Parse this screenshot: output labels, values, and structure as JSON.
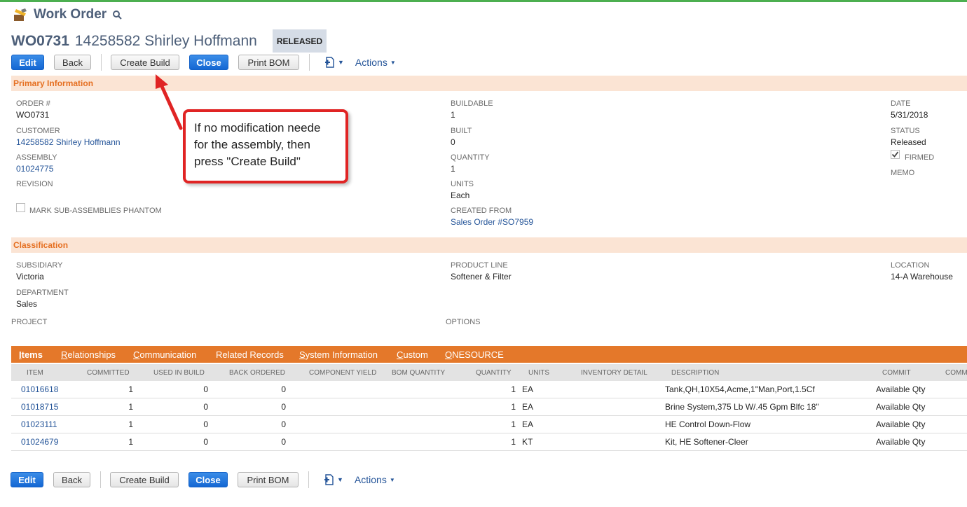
{
  "page": {
    "title": "Work Order",
    "record_id": "WO0731",
    "record_name": "14258582 Shirley Hoffmann",
    "status": "RELEASED"
  },
  "buttons": {
    "edit": "Edit",
    "back": "Back",
    "create_build": "Create Build",
    "close": "Close",
    "print_bom": "Print BOM",
    "actions": "Actions"
  },
  "primary": {
    "header": "Primary Information",
    "order_label": "ORDER #",
    "order_value": "WO0731",
    "customer_label": "CUSTOMER",
    "customer_value": "14258582 Shirley Hoffmann",
    "assembly_label": "ASSEMBLY",
    "assembly_value": "01024775",
    "revision_label": "REVISION",
    "phantom_label": "MARK SUB-ASSEMBLIES PHANTOM",
    "buildable_label": "BUILDABLE",
    "buildable_value": "1",
    "built_label": "BUILT",
    "built_value": "0",
    "quantity_label": "QUANTITY",
    "quantity_value": "1",
    "units_label": "UNITS",
    "units_value": "Each",
    "created_from_label": "CREATED FROM",
    "created_from_value": "Sales Order #SO7959",
    "date_label": "DATE",
    "date_value": "5/31/2018",
    "status_label": "STATUS",
    "status_value": "Released",
    "firmed_label": "FIRMED",
    "memo_label": "MEMO"
  },
  "classification": {
    "header": "Classification",
    "subsidiary_label": "SUBSIDIARY",
    "subsidiary_value": "Victoria",
    "department_label": "DEPARTMENT",
    "department_value": "Sales",
    "product_line_label": "PRODUCT LINE",
    "product_line_value": "Softener & Filter",
    "location_label": "LOCATION",
    "location_value": "14-A Warehouse",
    "project_label": "PROJECT",
    "options_label": "OPTIONS"
  },
  "tabs": [
    {
      "first": "I",
      "rest": "tems"
    },
    {
      "first": "R",
      "rest": "elationships"
    },
    {
      "first": "C",
      "rest": "ommunication"
    },
    {
      "first": "",
      "rest": "Related Records"
    },
    {
      "first": "S",
      "rest": "ystem Information"
    },
    {
      "first": "C",
      "rest": "ustom"
    },
    {
      "first": "O",
      "rest": "NESOURCE"
    }
  ],
  "items_columns": [
    "ITEM",
    "COMMITTED",
    "USED IN BUILD",
    "BACK ORDERED",
    "COMPONENT YIELD",
    "BOM QUANTITY",
    "QUANTITY",
    "UNITS",
    "INVENTORY DETAIL",
    "DESCRIPTION",
    "COMMIT",
    "COMMI"
  ],
  "items_rows": [
    {
      "item": "01016618",
      "committed": "1",
      "used": "0",
      "back": "0",
      "quantity": "1",
      "units": "EA",
      "description": "Tank,QH,10X54,Acme,1\"Man,Port,1.5Cf",
      "commit": "Available Qty"
    },
    {
      "item": "01018715",
      "committed": "1",
      "used": "0",
      "back": "0",
      "quantity": "1",
      "units": "EA",
      "description": "Brine System,375 Lb W/.45 Gpm Blfc 18\"",
      "commit": "Available Qty"
    },
    {
      "item": "01023111",
      "committed": "1",
      "used": "0",
      "back": "0",
      "quantity": "1",
      "units": "EA",
      "description": "HE Control Down-Flow",
      "commit": "Available Qty"
    },
    {
      "item": "01024679",
      "committed": "1",
      "used": "0",
      "back": "0",
      "quantity": "1",
      "units": "KT",
      "description": "Kit, HE Softener-Cleer",
      "commit": "Available Qty"
    }
  ],
  "callout": {
    "text": "If no modification neede for the assembly, then press \"Create Build\""
  },
  "colors": {
    "accent_orange": "#e4782a",
    "primary_blue": "#1467d3",
    "link_blue": "#255599",
    "callout_red": "#e02424"
  }
}
